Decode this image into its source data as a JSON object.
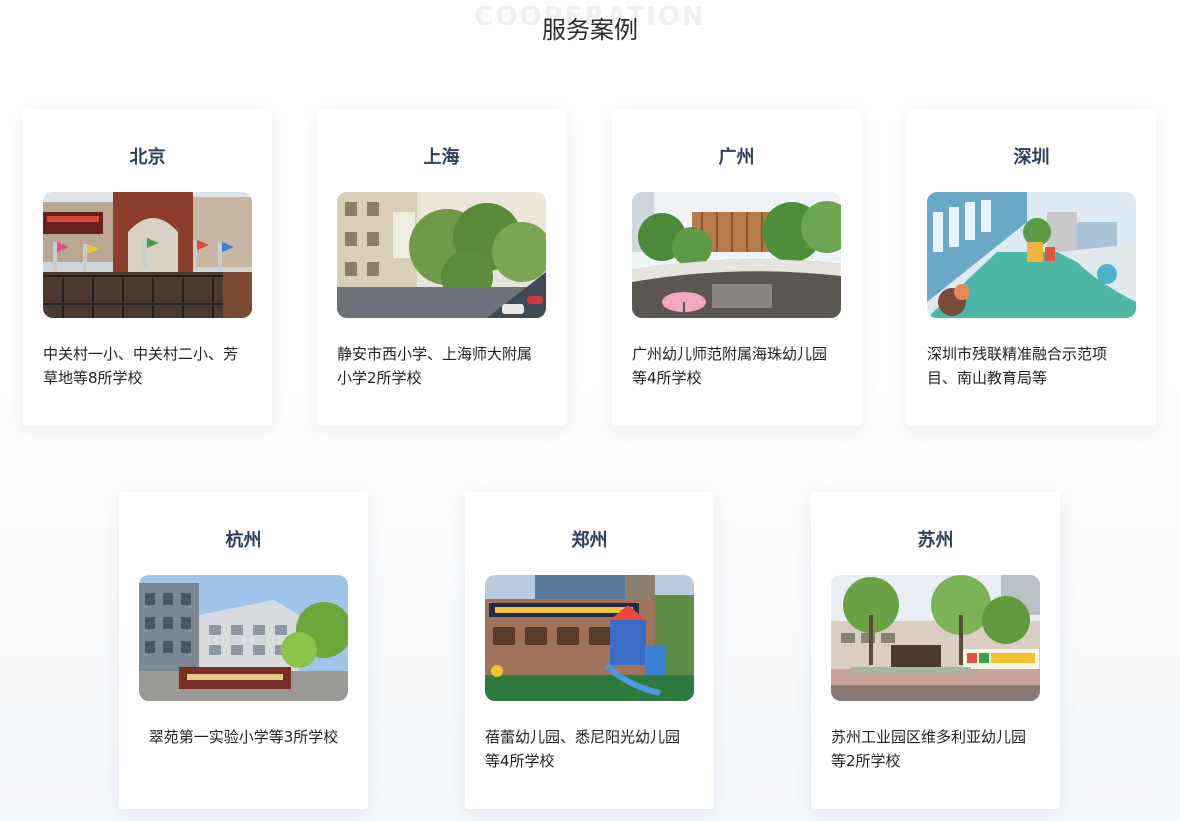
{
  "header": {
    "watermark": "COOPERATION",
    "title": "服务案例"
  },
  "cases": [
    {
      "city": "北京",
      "desc": "中关村一小、中关村二小、芳草地等8所学校",
      "photo": "beijing-school-photo"
    },
    {
      "city": "上海",
      "desc": "静安市西小学、上海师大附属小学2所学校",
      "photo": "shanghai-school-photo"
    },
    {
      "city": "广州",
      "desc": "广州幼儿师范附属海珠幼儿园等4所学校",
      "photo": "guangzhou-school-photo"
    },
    {
      "city": "深圳",
      "desc": "深圳市残联精准融合示范项目、南山教育局等",
      "photo": "shenzhen-school-photo"
    },
    {
      "city": "杭州",
      "desc": "翠苑第一实验小学等3所学校",
      "photo": "hangzhou-school-photo"
    },
    {
      "city": "郑州",
      "desc": "蓓蕾幼儿园、悉尼阳光幼儿园等4所学校",
      "photo": "zhengzhou-school-photo"
    },
    {
      "city": "苏州",
      "desc": "苏州工业园区维多利亚幼儿园等2所学校",
      "photo": "suzhou-school-photo"
    }
  ]
}
